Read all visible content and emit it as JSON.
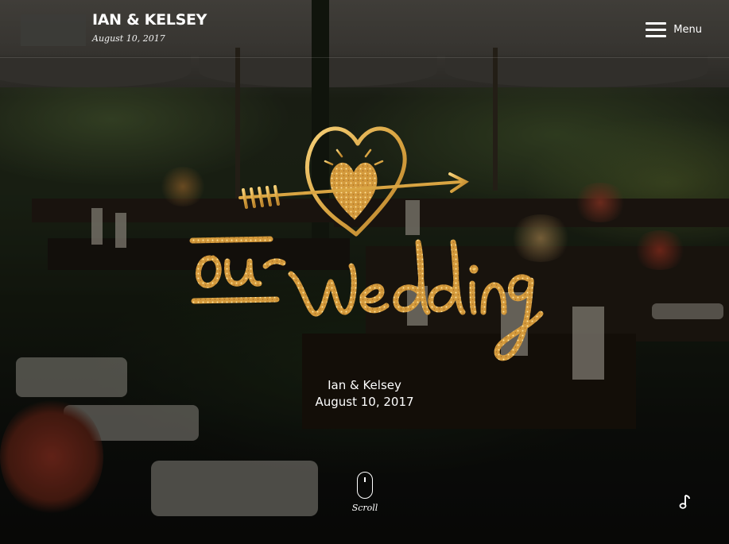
{
  "header": {
    "title": "IAN & KELSEY",
    "date": "August 10, 2017",
    "menu_label": "Menu",
    "menu_icon": "hamburger-icon"
  },
  "hero": {
    "artwork_text": "our wedding",
    "names": "Ian & Kelsey",
    "date": "August 10, 2017"
  },
  "scroll": {
    "label": "Scroll",
    "icon": "mouse-icon"
  },
  "music": {
    "icon": "music-note-icon"
  },
  "colors": {
    "gold": "#d9a441",
    "gold_light": "#f3c86a",
    "text": "#ffffff"
  }
}
